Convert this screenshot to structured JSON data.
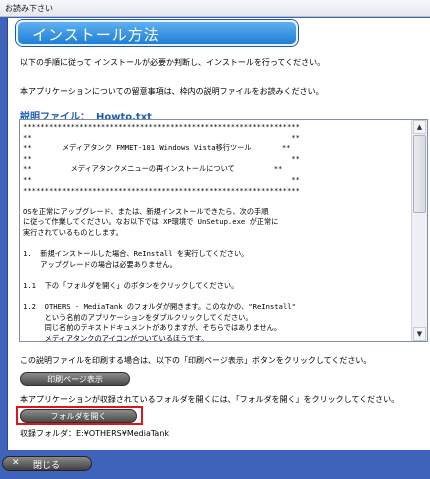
{
  "window": {
    "title": "お読み下さい"
  },
  "header": {
    "title": "インストール方法"
  },
  "intro": {
    "line1": "以下の手順に従って インストールが必要か判断し、インストールを行ってください。",
    "line2": "本アプリケーションについての留意事項は、枠内の説明ファイルをお読みください。"
  },
  "file": {
    "label": "説明ファイル：",
    "name": "Howto.txt"
  },
  "viewer": {
    "lines": [
      "****************************************************************",
      "**                                                            **",
      "**       メディアタンク FMMET-101 Windows Vista移行ツール       **",
      "**                                                            **",
      "**         メディアタンクメニューの再インストールについて         **",
      "**                                                            **",
      "****************************************************************",
      "",
      "OSを正常にアップグレード、または、新規インストールできたら、次の手順",
      "に従って作業してください。なお以下では XP環境で UnSetup.exe が正常に",
      "実行されているものとします。",
      "",
      "1.  新規インストールした場合、ReInstall を実行してください。",
      "    アップグレードの場合は必要ありません。",
      "",
      "1.1  下の「フォルダを開く」のボタンをクリックしてください。",
      "",
      "1.2  OTHERS - MediaTank のフォルダが開きます。このなかの、\"ReInstall\"",
      "     という名前のアプリケーションをダブルクリックしてください。",
      "     同じ名前のテキストドキュメントがありますが、そちらではありません。",
      "     メディアタンクのアイコンがついているほうです。"
    ]
  },
  "print": {
    "text": "この説明ファイルを印刷する場合は、以下の「印刷ページ表示」ボタンをクリックしてください。",
    "button": "印刷ページ表示"
  },
  "folder": {
    "text": "本アプリケーションが収録されているフォルダを開くには、「フォルダを開く」をクリックしてください。",
    "button": "フォルダを開く",
    "path_label": "収録フォルダ：",
    "path": "E:¥OTHERS¥MediaTank"
  },
  "footer": {
    "close_label": "閉じる"
  },
  "colors": {
    "frame": "#3f63b8",
    "header": "#1f7fd6",
    "highlight": "#e0141b"
  },
  "icons": {
    "close": "close-icon",
    "scroll_up": "scroll-up-arrow",
    "scroll_down": "scroll-down-arrow"
  }
}
